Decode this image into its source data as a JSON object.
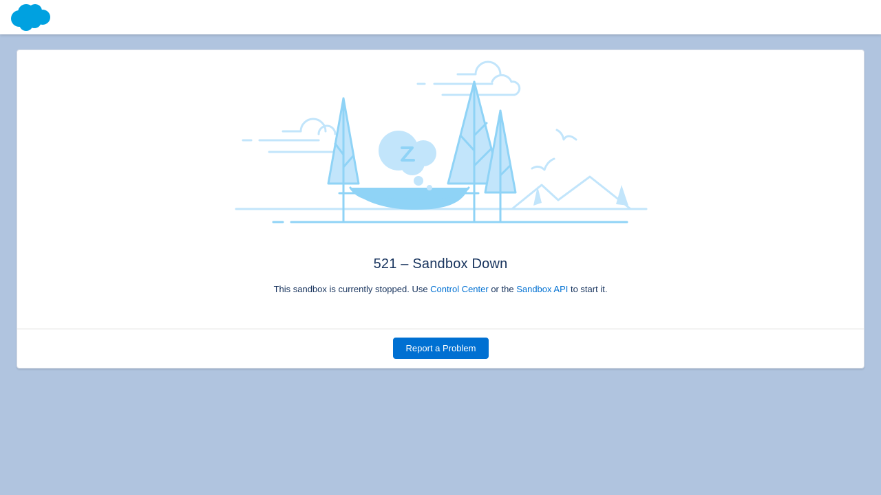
{
  "brand": {
    "logo_icon": "salesforce-cloud-icon",
    "color": "#00a1e0"
  },
  "error": {
    "title": "521 – Sandbox Down",
    "message_prefix": "This sandbox is currently stopped. Use ",
    "link_control_center": "Control Center",
    "message_middle": " or the ",
    "link_sandbox_api": "Sandbox API",
    "message_suffix": " to start it."
  },
  "actions": {
    "report_label": "Report a Problem"
  },
  "colors": {
    "background": "#b0c4df",
    "link": "#0070d2",
    "button": "#0070d2",
    "illustration_light": "#c2e5fb",
    "illustration_mid": "#8fd3f6"
  }
}
